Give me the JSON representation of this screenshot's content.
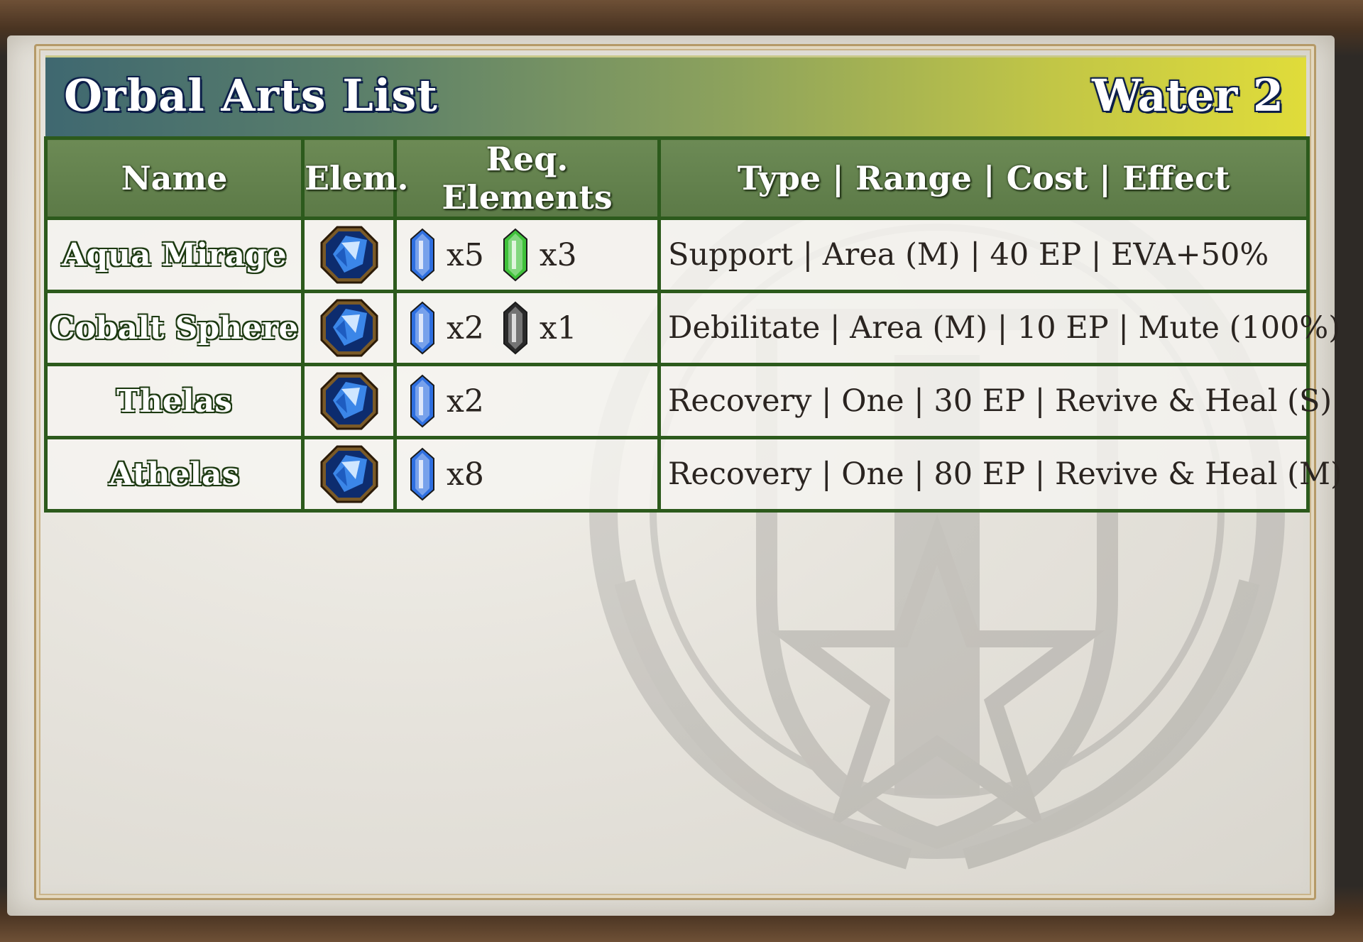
{
  "header": {
    "title": "Orbal Arts List",
    "category": "Water 2"
  },
  "columns": {
    "name": "Name",
    "elem": "Elem.",
    "req": "Req. Elements",
    "info": "Type | Range | Cost | Effect"
  },
  "rows": [
    {
      "name": "Aqua Mirage",
      "element_icon": "water-element-icon",
      "req": [
        {
          "gem": "water",
          "color": "#2e6fe0",
          "qty": "x5"
        },
        {
          "gem": "wind",
          "color": "#3fc23a",
          "qty": "x3"
        }
      ],
      "info": "Support | Area (M) | 40 EP | EVA+50%"
    },
    {
      "name": "Cobalt Sphere",
      "element_icon": "water-element-icon",
      "req": [
        {
          "gem": "water",
          "color": "#2e6fe0",
          "qty": "x2"
        },
        {
          "gem": "time",
          "color": "#2a2a2a",
          "qty": "x1"
        }
      ],
      "info": "Debilitate | Area (M) | 10 EP | Mute (100%)"
    },
    {
      "name": "Thelas",
      "element_icon": "water-element-icon",
      "req": [
        {
          "gem": "water",
          "color": "#2e6fe0",
          "qty": "x2"
        }
      ],
      "info": "Recovery | One | 30 EP | Revive & Heal (S)"
    },
    {
      "name": "Athelas",
      "element_icon": "water-element-icon",
      "req": [
        {
          "gem": "water",
          "color": "#2e6fe0",
          "qty": "x8"
        }
      ],
      "info": "Recovery | One | 80 EP | Revive & Heal (M)"
    }
  ],
  "colors": {
    "header_gradient_start": "#3f6870",
    "header_gradient_end": "#e0dc3a",
    "table_border": "#2c5a1c",
    "column_header_bg": "#6c8a55"
  }
}
